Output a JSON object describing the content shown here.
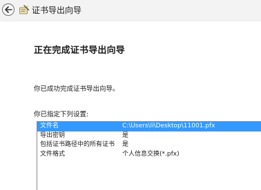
{
  "wizard": {
    "title": "证书导出向导",
    "heading": "正在完成证书导出向导",
    "success_message": "你已成功完成证书导出向导。",
    "specified_label": "你已指定下列设置:"
  },
  "settings": [
    {
      "name": "文件名",
      "value": "C:\\Users\\li\\Desktop\\11001.pfx"
    },
    {
      "name": "导出密钥",
      "value": "是"
    },
    {
      "name": "包括证书路径中的所有证书",
      "value": "是"
    },
    {
      "name": "文件格式",
      "value": "个人信息交换(*.pfx)"
    }
  ],
  "selected_row_color": "#3399ff",
  "icons": {
    "back": "back-arrow-icon",
    "wizard": "certificate-wizard-icon"
  }
}
